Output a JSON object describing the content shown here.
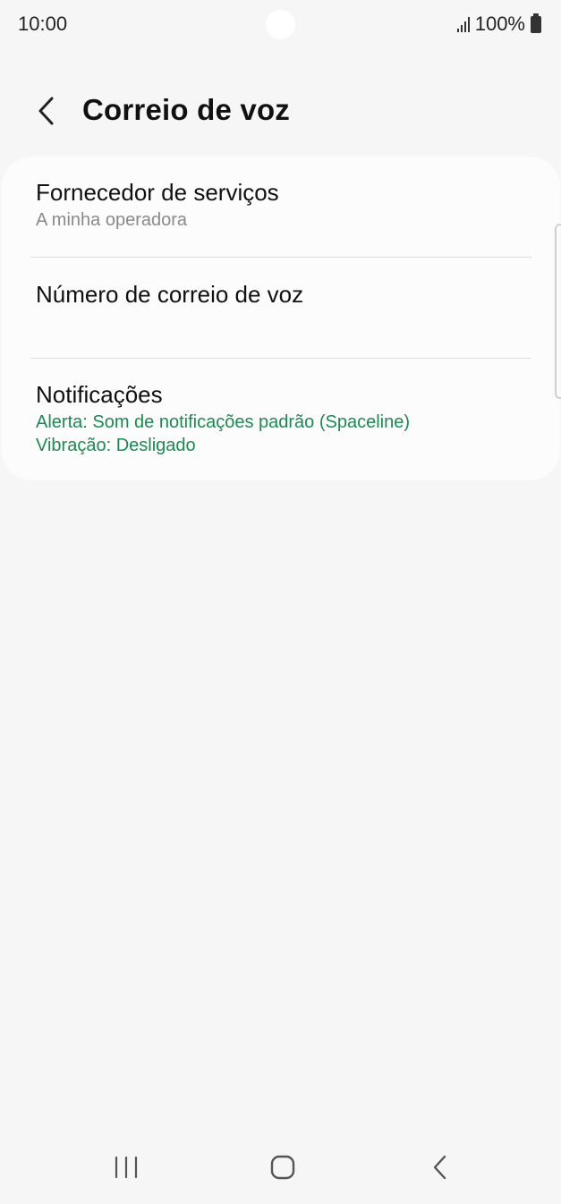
{
  "status_bar": {
    "time": "10:00",
    "battery": "100%"
  },
  "header": {
    "title": "Correio de voz"
  },
  "settings": {
    "items": [
      {
        "title": "Fornecedor de serviços",
        "subtitle": "A minha operadora"
      },
      {
        "title": "Número de correio de voz"
      },
      {
        "title": "Notificações",
        "subtitle_lines": [
          "Alerta: Som de notificações padrão (Spaceline)",
          "Vibração: Desligado"
        ]
      }
    ]
  },
  "colors": {
    "accent_green": "#1a8a52",
    "background": "#f6f6f6",
    "card": "#fcfcfc"
  },
  "icons": {
    "back": "chevron-left-icon",
    "recents": "recents-icon",
    "home": "home-icon",
    "nav_back": "nav-back-icon"
  }
}
